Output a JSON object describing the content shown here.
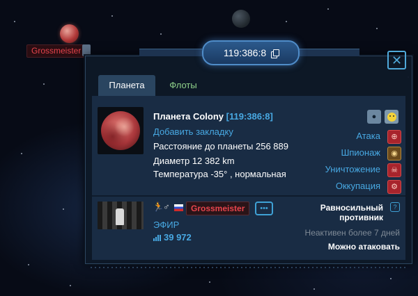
{
  "map": {
    "owner_tag": "Grossmeister"
  },
  "header": {
    "coordinates": "119:386:8",
    "copy_icon": "copy-icon",
    "close_symbol": "✕"
  },
  "tabs": [
    {
      "label": "Планета",
      "active": true
    },
    {
      "label": "Флоты",
      "active": false
    }
  ],
  "planet": {
    "title": "Планета Colony",
    "coords": "[119:386:8]",
    "bookmark": "Добавить закладку",
    "distance": "Расстояние до планеты 256 889",
    "diameter": "Диаметр 12 382 km",
    "temperature": "Температура -35° , нормальная"
  },
  "top_buttons": {
    "eye_icon": "eye-icon",
    "face_icon": "smiley-icon"
  },
  "actions": [
    {
      "label": "Атака",
      "icon": "attack-icon",
      "glyph": "⊕"
    },
    {
      "label": "Шпионаж",
      "icon": "spy-eye-icon",
      "glyph": "◉"
    },
    {
      "label": "Уничтожение",
      "icon": "skull-icon",
      "glyph": "☠"
    },
    {
      "label": "Оккупация",
      "icon": "occupation-icon",
      "glyph": "⚙"
    }
  ],
  "player": {
    "name": "Grossmeister",
    "alliance": "ЭФИР",
    "score": "39 972",
    "runner_glyph": "🏃",
    "gender_glyph": "♂",
    "chat_glyph": "•••",
    "status_title": "Равносильный противник",
    "help_glyph": "?",
    "inactive": "Неактивен более 7 дней",
    "attackable": "Можно атаковать"
  },
  "colors": {
    "accent_blue": "#48a9e3",
    "enemy_red": "#e6444c",
    "tab_green": "#8fd18a"
  }
}
